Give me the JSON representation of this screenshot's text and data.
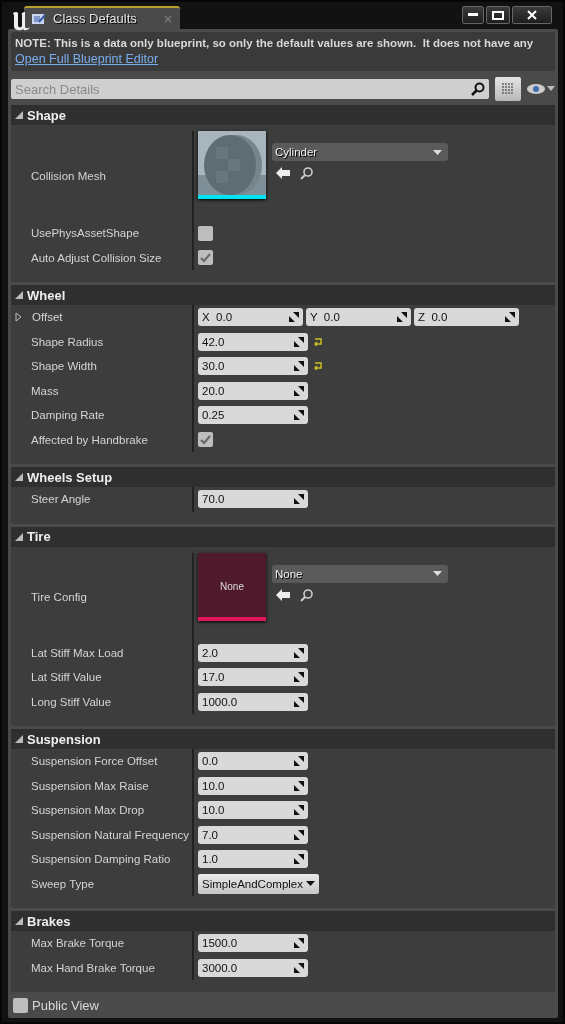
{
  "window": {
    "tab": {
      "label": "Class Defaults",
      "selected": true
    }
  },
  "note": {
    "text": "NOTE: This is a data only blueprint, so only the default values are shown.  It does not have any",
    "link": "Open Full Blueprint Editor"
  },
  "search": {
    "placeholder": "Search Details"
  },
  "sections": [
    {
      "title": "Shape",
      "expanded": true,
      "rows": [
        {
          "kind": "asset",
          "label": "Collision Mesh",
          "value": "Cylinder",
          "color": "#00e5f5"
        },
        {
          "kind": "checkbox",
          "label": "UsePhysAssetShape",
          "checked": false
        },
        {
          "kind": "checkbox",
          "label": "Auto Adjust Collision Size",
          "checked": true
        }
      ]
    },
    {
      "title": "Wheel",
      "expanded": true,
      "rows": [
        {
          "kind": "vector",
          "label": "Offset",
          "expanded": false,
          "fields": [
            {
              "axis": "X",
              "value": "0.0"
            },
            {
              "axis": "Y",
              "value": "0.0"
            },
            {
              "axis": "Z",
              "value": "0.0"
            }
          ]
        },
        {
          "kind": "number",
          "label": "Shape Radius",
          "value": "42.0",
          "reset": true
        },
        {
          "kind": "number",
          "label": "Shape Width",
          "value": "30.0",
          "reset": true
        },
        {
          "kind": "number",
          "label": "Mass",
          "value": "20.0",
          "reset": false
        },
        {
          "kind": "number",
          "label": "Damping Rate",
          "value": "0.25",
          "reset": false
        },
        {
          "kind": "checkbox",
          "label": "Affected by Handbrake",
          "checked": true
        }
      ]
    },
    {
      "title": "Wheels Setup",
      "expanded": true,
      "rows": [
        {
          "kind": "number",
          "label": "Steer Angle",
          "value": "70.0",
          "reset": false
        }
      ]
    },
    {
      "title": "Tire",
      "expanded": true,
      "rows": [
        {
          "kind": "asset",
          "label": "Tire Config",
          "value": "None",
          "thumbnail_label": "None",
          "color": "#e0185a"
        },
        {
          "kind": "number",
          "label": "Lat Stiff Max Load",
          "value": "2.0",
          "reset": false
        },
        {
          "kind": "number",
          "label": "Lat Stiff Value",
          "value": "17.0",
          "reset": false
        },
        {
          "kind": "number",
          "label": "Long Stiff Value",
          "value": "1000.0",
          "reset": false
        }
      ]
    },
    {
      "title": "Suspension",
      "expanded": true,
      "rows": [
        {
          "kind": "number",
          "label": "Suspension Force Offset",
          "value": "0.0",
          "reset": false
        },
        {
          "kind": "number",
          "label": "Suspension Max Raise",
          "value": "10.0",
          "reset": false
        },
        {
          "kind": "number",
          "label": "Suspension Max Drop",
          "value": "10.0",
          "reset": false
        },
        {
          "kind": "number",
          "label": "Suspension Natural Frequency",
          "value": "7.0",
          "reset": false
        },
        {
          "kind": "number",
          "label": "Suspension Damping Ratio",
          "value": "1.0",
          "reset": false
        },
        {
          "kind": "enum",
          "label": "Sweep Type",
          "value": "SimpleAndComplex"
        }
      ]
    },
    {
      "title": "Brakes",
      "expanded": true,
      "rows": [
        {
          "kind": "number",
          "label": "Max Brake Torque",
          "value": "1500.0",
          "reset": false
        },
        {
          "kind": "number",
          "label": "Max Hand Brake Torque",
          "value": "3000.0",
          "reset": false
        }
      ]
    }
  ],
  "footer": {
    "label": "Public View",
    "checked": false
  }
}
